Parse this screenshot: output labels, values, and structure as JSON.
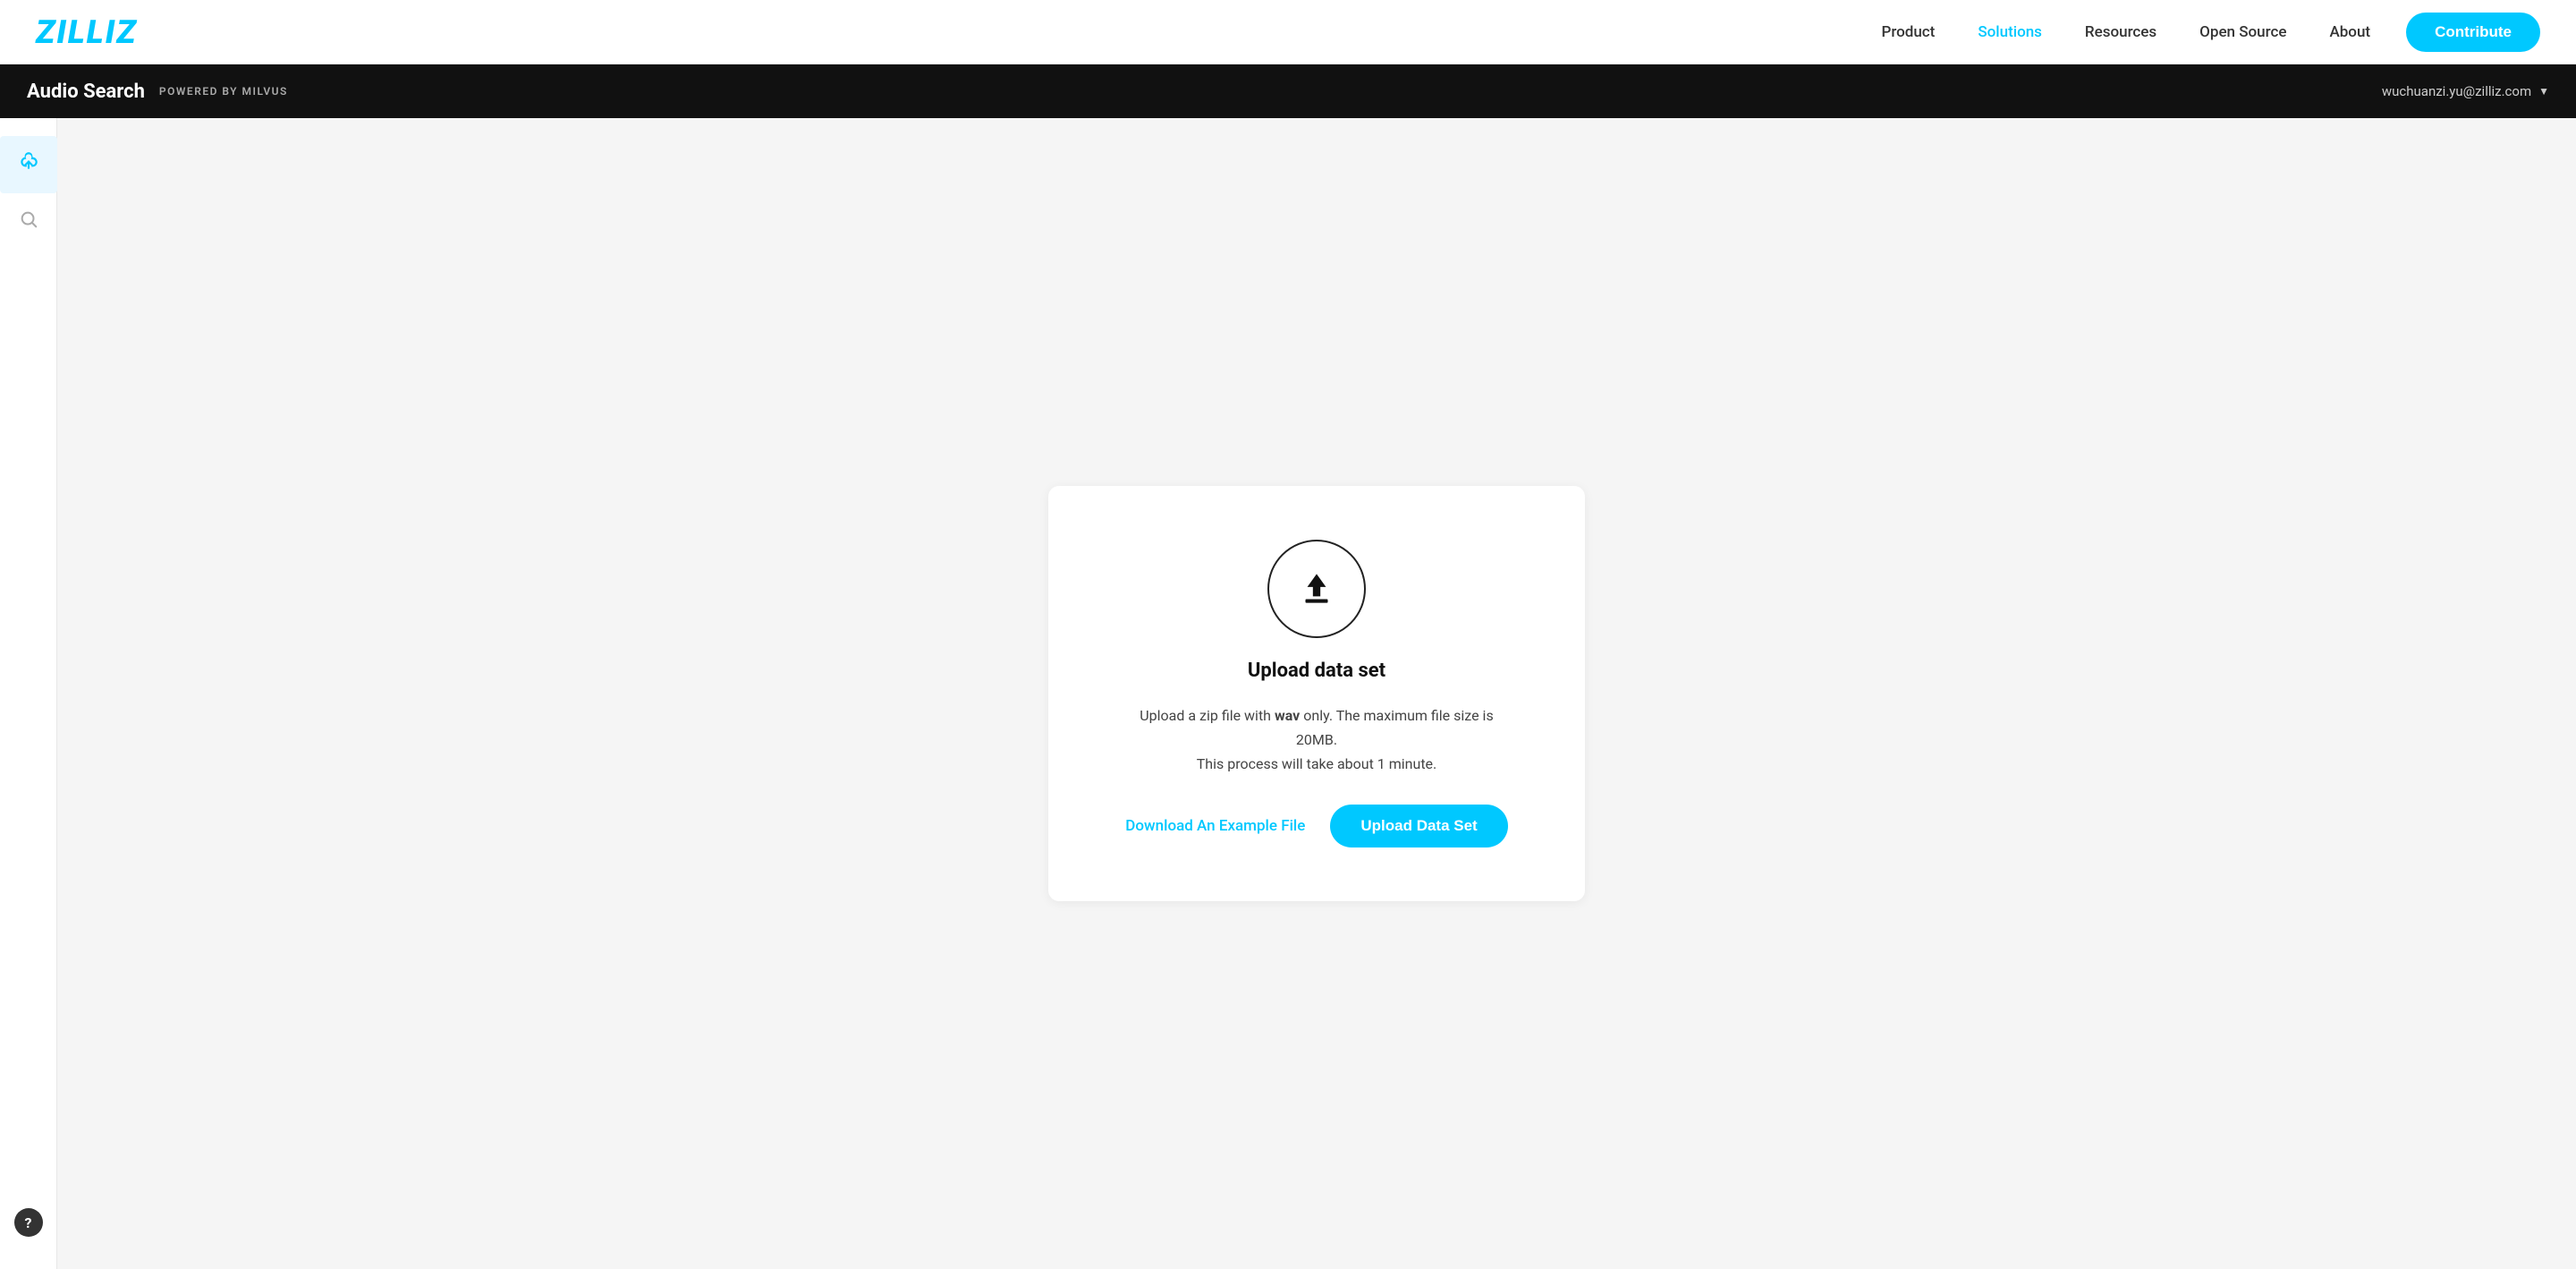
{
  "nav": {
    "logo": "ZILLIZ",
    "links": [
      {
        "label": "Product",
        "active": false
      },
      {
        "label": "Solutions",
        "active": true
      },
      {
        "label": "Resources",
        "active": false
      },
      {
        "label": "Open Source",
        "active": false
      },
      {
        "label": "About",
        "active": false
      }
    ],
    "contribute_label": "Contribute"
  },
  "black_bar": {
    "title": "Audio Search",
    "subtitle": "POWERED BY MILVUS",
    "user_email": "wuchuanzi.yu@zilliz.com"
  },
  "sidebar": {
    "upload_tooltip": "Upload",
    "search_tooltip": "Search",
    "help_label": "?"
  },
  "upload_section": {
    "title": "Upload data set",
    "description_prefix": "Upload a zip file with ",
    "description_format": "wav",
    "description_suffix": " only. The maximum file size is 20MB.",
    "process_note": "This process will take about 1 minute.",
    "download_label": "Download An Example File",
    "upload_button_label": "Upload Data Set"
  }
}
